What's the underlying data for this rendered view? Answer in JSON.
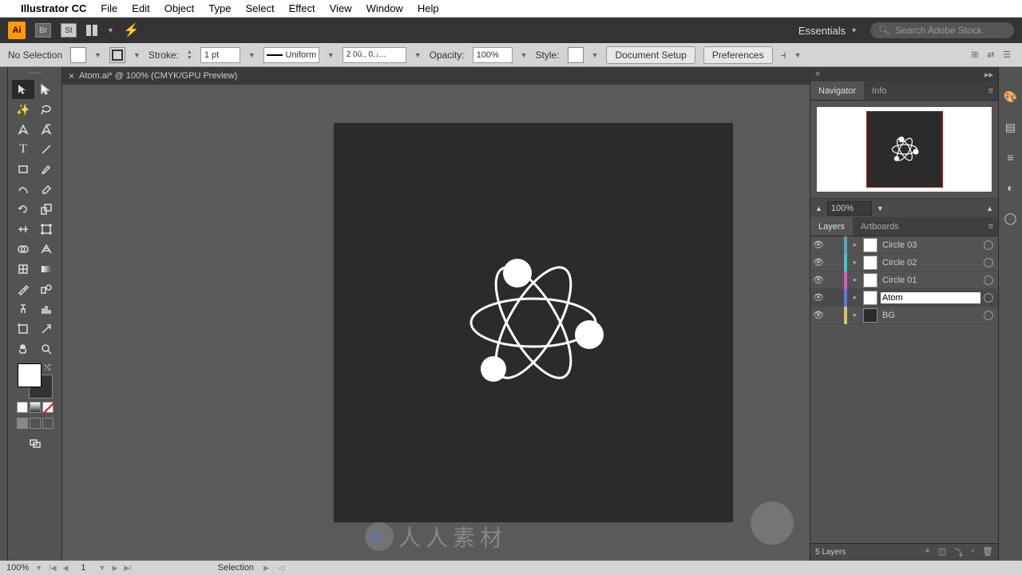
{
  "menubar": {
    "app": "Illustrator CC",
    "items": [
      "File",
      "Edit",
      "Object",
      "Type",
      "Select",
      "Effect",
      "View",
      "Window",
      "Help"
    ]
  },
  "appbar": {
    "ai": "Ai",
    "br": "Br",
    "st": "St",
    "workspace": "Essentials",
    "search_placeholder": "Search Adobe Stock"
  },
  "control": {
    "selection": "No Selection",
    "stroke_label": "Stroke:",
    "stroke_val": "1 pt",
    "profile": "Uniform",
    "dash": "2 0û., 0,↓...",
    "opacity_label": "Opacity:",
    "opacity_val": "100%",
    "style_label": "Style:",
    "doc_setup": "Document Setup",
    "prefs": "Preferences"
  },
  "doc": {
    "title": "Atom.ai* @ 100% (CMYK/GPU Preview)"
  },
  "nav": {
    "tab1": "Navigator",
    "tab2": "Info",
    "zoom": "100%"
  },
  "layers": {
    "tab1": "Layers",
    "tab2": "Artboards",
    "count": "5 Layers",
    "rows": [
      {
        "name": "Circle 03",
        "color": "#5aa0c8",
        "thumb": "#fff"
      },
      {
        "name": "Circle 02",
        "color": "#3cc8c8",
        "thumb": "#fff"
      },
      {
        "name": "Circle 01",
        "color": "#d85ac8",
        "thumb": "#fff"
      },
      {
        "name": "Atom",
        "color": "#5a7ae0",
        "thumb": "#fff",
        "editing": true,
        "selected": true
      },
      {
        "name": "BG",
        "color": "#d8c85a",
        "thumb": "#2b2b2b"
      }
    ]
  },
  "status": {
    "zoom": "100%",
    "artboard": "1",
    "tool": "Selection"
  },
  "watermark": "人人素材"
}
